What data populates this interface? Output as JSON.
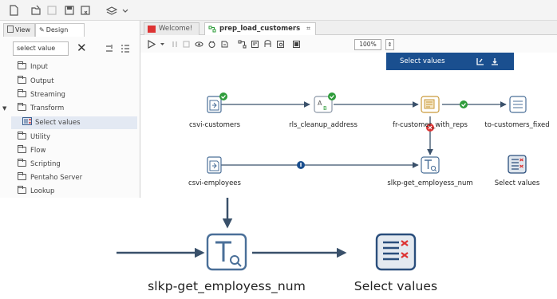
{
  "left_panel": {
    "tabs": [
      "View",
      "Design"
    ],
    "search_value": "select value",
    "tree": [
      "Input",
      "Output",
      "Streaming",
      "Transform",
      "Select values",
      "Utility",
      "Flow",
      "Scripting",
      "Pentaho Server",
      "Lookup"
    ]
  },
  "editor": {
    "tabs": [
      "Welcome!",
      "prep_load_customers"
    ],
    "zoom": "100%"
  },
  "step_toolbar": {
    "label": "Select values"
  },
  "steps": {
    "csvi_customers": "csvi-customers",
    "rls_cleanup_address": "rls_cleanup_address",
    "fr_customer_with_reps": "fr-customer_with_reps",
    "to_customers_fixed": "to-customers_fixed",
    "csvi_employees": "csvi-employees",
    "slkp_get_employess_num": "slkp-get_employess_num",
    "select_values": "Select values"
  },
  "colors": {
    "accent_blue": "#1a4f8f",
    "hop_line": "#39506a",
    "ok_green": "#2e9c3a",
    "error_red": "#d33"
  }
}
